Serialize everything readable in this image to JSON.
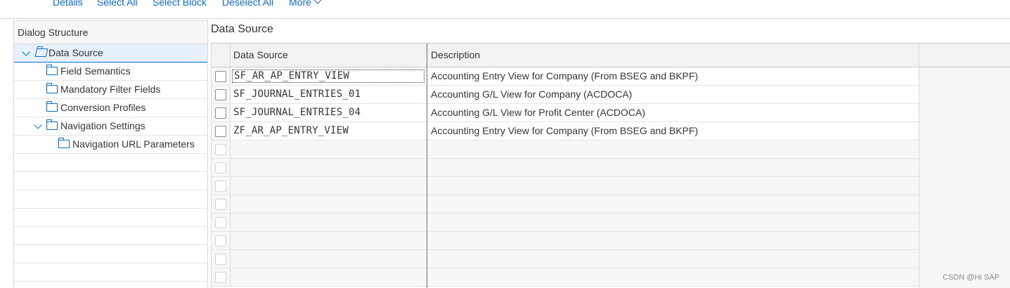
{
  "toolbar": {
    "details_label": "Details",
    "select_all_label": "Select All",
    "select_block_label": "Select Block",
    "deselect_all_label": "Deselect All",
    "more_label": "More"
  },
  "dialog_structure": {
    "title": "Dialog Structure",
    "items": [
      {
        "label": "Data Source",
        "level": 0,
        "expanded": true,
        "selected": true
      },
      {
        "label": "Field Semantics",
        "level": 1
      },
      {
        "label": "Mandatory Filter Fields",
        "level": 1
      },
      {
        "label": "Conversion Profiles",
        "level": 1
      },
      {
        "label": "Navigation Settings",
        "level": 1,
        "expanded": true
      },
      {
        "label": "Navigation URL Parameters",
        "level": 2
      }
    ]
  },
  "main": {
    "title": "Data Source",
    "columns": [
      "Data Source",
      "Description"
    ],
    "rows": [
      {
        "data_source": "SF_AR_AP_ENTRY_VIEW",
        "description": "Accounting Entry View for Company (From BSEG and BKPF)"
      },
      {
        "data_source": "SF_JOURNAL_ENTRIES_01",
        "description": "Accounting G/L View for Company (ACDOCA)"
      },
      {
        "data_source": "SF_JOURNAL_ENTRIES_04",
        "description": "Accounting G/L View for Profit Center (ACDOCA)"
      },
      {
        "data_source": "ZF_AR_AP_ENTRY_VIEW",
        "description": "Accounting Entry View for Company (From BSEG and BKPF)"
      }
    ]
  },
  "watermark": "CSDN @Hi SAP",
  "colors": {
    "accent": "#0a6ed1",
    "selected_row": "#e5f0fa"
  }
}
